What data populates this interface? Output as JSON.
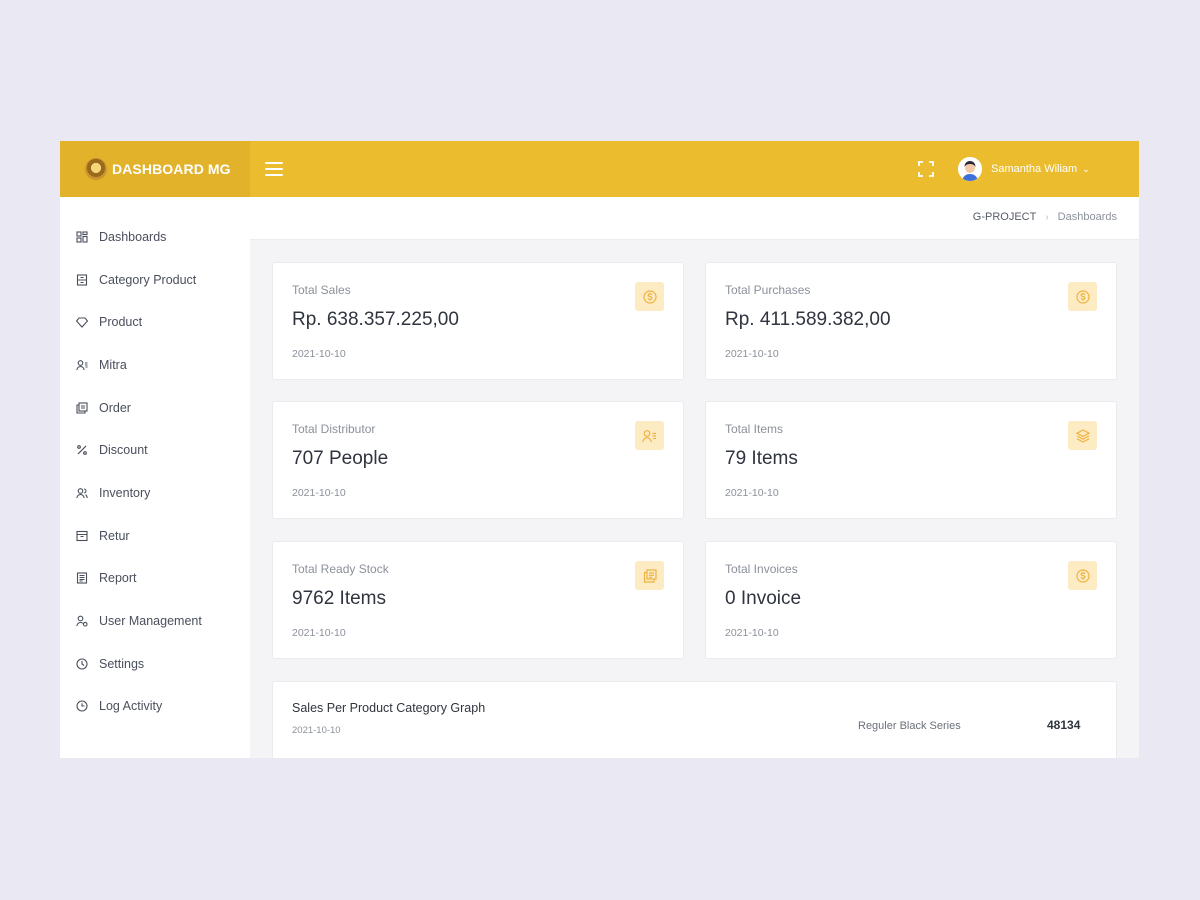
{
  "app": {
    "brand": "DASHBOARD MG",
    "accent_color": "#ebbd2e",
    "icon_bg_color": "#fdebc4",
    "icon_color": "#efb240"
  },
  "topbar": {
    "menu_icon": "hamburger-icon",
    "fullscreen_icon": "fullscreen-icon",
    "user_name": "Samantha Wiliam"
  },
  "sidebar": {
    "items": [
      {
        "label": "Dashboards",
        "icon": "grid-icon"
      },
      {
        "label": "Category Product",
        "icon": "box-icon"
      },
      {
        "label": "Product",
        "icon": "diamond-icon"
      },
      {
        "label": "Mitra",
        "icon": "user-list-icon"
      },
      {
        "label": "Order",
        "icon": "copy-icon"
      },
      {
        "label": "Discount",
        "icon": "percent-icon"
      },
      {
        "label": "Inventory",
        "icon": "users-icon"
      },
      {
        "label": "Retur",
        "icon": "archive-icon"
      },
      {
        "label": "Report",
        "icon": "file-icon"
      },
      {
        "label": "User Management",
        "icon": "user-settings-icon"
      },
      {
        "label": "Settings",
        "icon": "settings-icon"
      },
      {
        "label": "Log Activity",
        "icon": "clock-icon"
      }
    ]
  },
  "breadcrumb": {
    "root": "G-PROJECT",
    "current": "Dashboards"
  },
  "cards": [
    {
      "label": "Total Sales",
      "value": "Rp. 638.357.225,00",
      "date": "2021-10-10",
      "icon": "coin-icon"
    },
    {
      "label": "Total Purchases",
      "value": "Rp. 411.589.382,00",
      "date": "2021-10-10",
      "icon": "coin-icon"
    },
    {
      "label": "Total Distributor",
      "value": "707 People",
      "date": "2021-10-10",
      "icon": "user-list-icon"
    },
    {
      "label": "Total Items",
      "value": "79 Items",
      "date": "2021-10-10",
      "icon": "layers-icon"
    },
    {
      "label": "Total Ready Stock",
      "value": "9762 Items",
      "date": "2021-10-10",
      "icon": "copy-icon"
    },
    {
      "label": "Total Invoices",
      "value": "0 Invoice",
      "date": "2021-10-10",
      "icon": "coin-icon"
    }
  ],
  "graph": {
    "title": "Sales Per Product Category Graph",
    "date": "2021-10-10",
    "series_name": "Reguler Black Series",
    "series_value": "48134"
  }
}
